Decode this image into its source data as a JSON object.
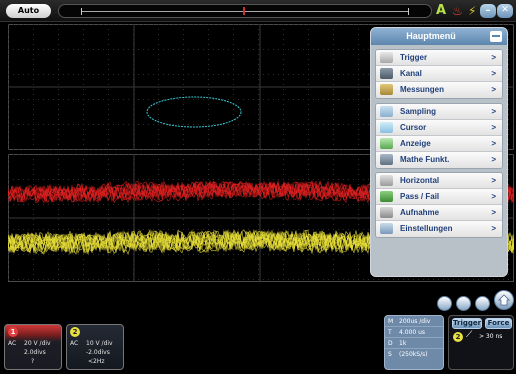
{
  "toolbar": {
    "auto_label": "Auto",
    "a_glyph": "A",
    "fire_glyph": "♨",
    "bolt_glyph": "⚡",
    "minimize_glyph": "–",
    "close_glyph": "✕"
  },
  "menu": {
    "title": "Hauptmenü",
    "groups": [
      {
        "items": [
          {
            "label": "Trigger",
            "icon": "hand-icon",
            "arrow": ">"
          },
          {
            "label": "Kanal",
            "icon": "channel-icon",
            "arrow": ">"
          },
          {
            "label": "Messungen",
            "icon": "ruler-icon",
            "arrow": ">"
          }
        ]
      },
      {
        "items": [
          {
            "label": "Sampling",
            "icon": "sampling-icon",
            "arrow": ">"
          },
          {
            "label": "Cursor",
            "icon": "cursor-icon",
            "arrow": ">"
          },
          {
            "label": "Anzeige",
            "icon": "display-icon",
            "arrow": ">"
          },
          {
            "label": "Mathe Funkt.",
            "icon": "math-icon",
            "arrow": ">"
          }
        ]
      },
      {
        "items": [
          {
            "label": "Horizontal",
            "icon": "wrench-icon",
            "arrow": ">"
          },
          {
            "label": "Pass / Fail",
            "icon": "pass-fail-icon",
            "arrow": ">"
          },
          {
            "label": "Aufnahme",
            "icon": "record-icon",
            "arrow": ">"
          },
          {
            "label": "Einstellungen",
            "icon": "settings-icon",
            "arrow": ">"
          }
        ]
      }
    ]
  },
  "channels": {
    "ch1": {
      "number": "1",
      "coupling": "AC",
      "vdiv": "20 V /div",
      "offset": "2.0divs",
      "extra": "?"
    },
    "ch2": {
      "number": "2",
      "coupling": "AC",
      "vdiv": "10 V /div",
      "offset": "-2.0divs",
      "extra": "<2Hz"
    }
  },
  "timebase": {
    "rows": [
      {
        "key": "M",
        "value": "200us /div"
      },
      {
        "key": "T",
        "value": "4.000 us"
      },
      {
        "key": "D",
        "value": "1k"
      },
      {
        "key": "S",
        "value": "(250kS/s)"
      }
    ]
  },
  "trigger": {
    "trigger_label": "Trigger",
    "force_label": "Force",
    "source": "2",
    "edge_glyph": "⟋",
    "condition": "> 30 ns"
  },
  "markers": {
    "ch1_marker": "1",
    "ch2_marker": "2"
  },
  "colors": {
    "ch1": "#e02020",
    "ch2": "#e8e038",
    "xy_trace": "#38c8d8",
    "grid": "#3a3a3a",
    "menu_accent": "#5d86ad"
  }
}
